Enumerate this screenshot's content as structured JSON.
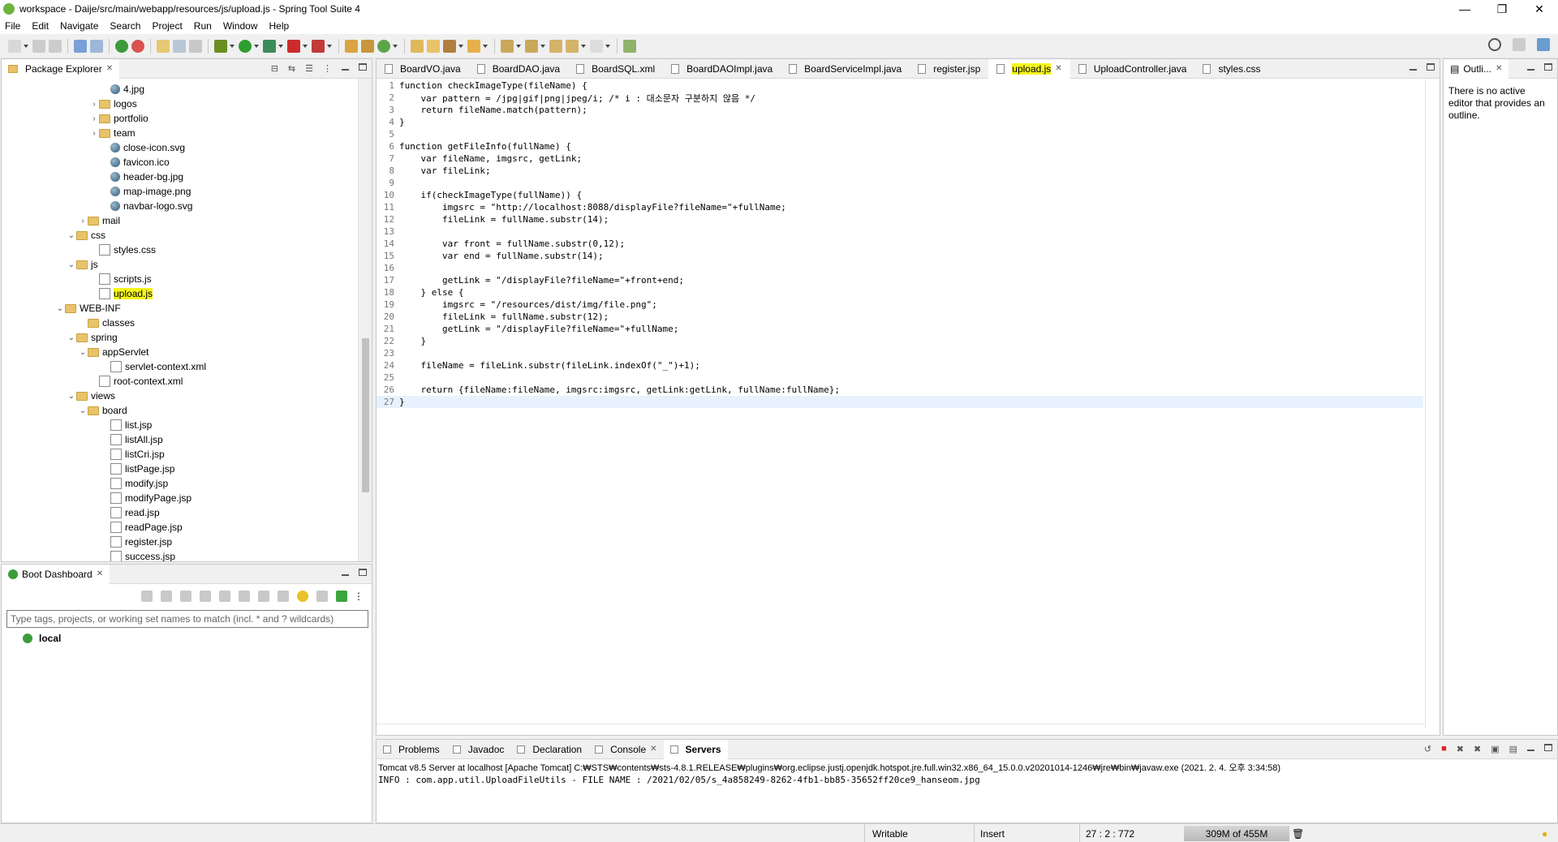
{
  "window": {
    "title": "workspace - Daije/src/main/webapp/resources/js/upload.js - Spring Tool Suite 4"
  },
  "menu": [
    "File",
    "Edit",
    "Navigate",
    "Search",
    "Project",
    "Run",
    "Window",
    "Help"
  ],
  "package_explorer": {
    "title": "Package Explorer",
    "items": [
      {
        "label": "4.jpg",
        "type": "image",
        "level": 9,
        "expander": ""
      },
      {
        "label": "logos",
        "type": "folder",
        "level": 8,
        "expander": ">"
      },
      {
        "label": "portfolio",
        "type": "folder",
        "level": 8,
        "expander": ">"
      },
      {
        "label": "team",
        "type": "folder",
        "level": 8,
        "expander": ">"
      },
      {
        "label": "close-icon.svg",
        "type": "image",
        "level": 9,
        "expander": ""
      },
      {
        "label": "favicon.ico",
        "type": "image",
        "level": 9,
        "expander": ""
      },
      {
        "label": "header-bg.jpg",
        "type": "image",
        "level": 9,
        "expander": ""
      },
      {
        "label": "map-image.png",
        "type": "image",
        "level": 9,
        "expander": ""
      },
      {
        "label": "navbar-logo.svg",
        "type": "image",
        "level": 9,
        "expander": ""
      },
      {
        "label": "mail",
        "type": "folder",
        "level": 7,
        "expander": ">"
      },
      {
        "label": "css",
        "type": "folder",
        "level": 6,
        "expander": "v"
      },
      {
        "label": "styles.css",
        "type": "file",
        "level": 8,
        "expander": ""
      },
      {
        "label": "js",
        "type": "folder",
        "level": 6,
        "expander": "v"
      },
      {
        "label": "scripts.js",
        "type": "file",
        "level": 8,
        "expander": ""
      },
      {
        "label": "upload.js",
        "type": "file",
        "level": 8,
        "expander": "",
        "selected": true
      },
      {
        "label": "WEB-INF",
        "type": "folder",
        "level": 5,
        "expander": "v"
      },
      {
        "label": "classes",
        "type": "folder",
        "level": 7,
        "expander": ""
      },
      {
        "label": "spring",
        "type": "folder",
        "level": 6,
        "expander": "v"
      },
      {
        "label": "appServlet",
        "type": "folder",
        "level": 7,
        "expander": "v"
      },
      {
        "label": "servlet-context.xml",
        "type": "file",
        "level": 9,
        "expander": ""
      },
      {
        "label": "root-context.xml",
        "type": "file",
        "level": 8,
        "expander": ""
      },
      {
        "label": "views",
        "type": "folder",
        "level": 6,
        "expander": "v"
      },
      {
        "label": "board",
        "type": "folder",
        "level": 7,
        "expander": "v"
      },
      {
        "label": "list.jsp",
        "type": "file",
        "level": 9,
        "expander": ""
      },
      {
        "label": "listAll.jsp",
        "type": "file",
        "level": 9,
        "expander": ""
      },
      {
        "label": "listCri.jsp",
        "type": "file",
        "level": 9,
        "expander": ""
      },
      {
        "label": "listPage.jsp",
        "type": "file",
        "level": 9,
        "expander": ""
      },
      {
        "label": "modify.jsp",
        "type": "file",
        "level": 9,
        "expander": ""
      },
      {
        "label": "modifyPage.jsp",
        "type": "file",
        "level": 9,
        "expander": ""
      },
      {
        "label": "read.jsp",
        "type": "file",
        "level": 9,
        "expander": ""
      },
      {
        "label": "readPage.jsp",
        "type": "file",
        "level": 9,
        "expander": ""
      },
      {
        "label": "register.jsp",
        "type": "file",
        "level": 9,
        "expander": ""
      },
      {
        "label": "success.jsp",
        "type": "file",
        "level": 9,
        "expander": ""
      }
    ]
  },
  "boot_dashboard": {
    "title": "Boot Dashboard",
    "filter_placeholder": "Type tags, projects, or working set names to match (incl. * and ? wildcards)",
    "local": "local"
  },
  "editor": {
    "tabs": [
      "BoardVO.java",
      "BoardDAO.java",
      "BoardSQL.xml",
      "BoardDAOImpl.java",
      "BoardServiceImpl.java",
      "register.jsp",
      "upload.js",
      "UploadController.java",
      "styles.css"
    ],
    "active_tab": "upload.js",
    "lines": [
      "function checkImageType(fileName) {",
      "    var pattern = /jpg|gif|png|jpeg/i; /* i : 대소문자 구분하지 않음 */",
      "    return fileName.match(pattern);",
      "}",
      "",
      "function getFileInfo(fullName) {",
      "    var fileName, imgsrc, getLink;",
      "    var fileLink;",
      "",
      "    if(checkImageType(fullName)) {",
      "        imgsrc = \"http://localhost:8088/displayFile?fileName=\"+fullName;",
      "        fileLink = fullName.substr(14);",
      "",
      "        var front = fullName.substr(0,12);",
      "        var end = fullName.substr(14);",
      "",
      "        getLink = \"/displayFile?fileName=\"+front+end;",
      "    } else {",
      "        imgsrc = \"/resources/dist/img/file.png\";",
      "        fileLink = fullName.substr(12);",
      "        getLink = \"/displayFile?fileName=\"+fullName;",
      "    }",
      "",
      "    fileName = fileLink.substr(fileLink.indexOf(\"_\")+1);",
      "",
      "    return {fileName:fileName, imgsrc:imgsrc, getLink:getLink, fullName:fullName};",
      "}"
    ]
  },
  "outline": {
    "title": "Outli...",
    "message": "There is no active editor that provides an outline."
  },
  "console": {
    "tabs": [
      "Problems",
      "Javadoc",
      "Declaration",
      "Console",
      "Servers"
    ],
    "header": "Tomcat v8.5 Server at localhost [Apache Tomcat] C:₩STS₩contents₩sts-4.8.1.RELEASE₩plugins₩org.eclipse.justj.openjdk.hotspot.jre.full.win32.x86_64_15.0.0.v20201014-1246₩jre₩bin₩javaw.exe  (2021. 2. 4. 오후 3:34:58)",
    "log": "INFO : com.app.util.UploadFileUtils - FILE NAME : /2021/02/05/s_4a858249-8262-4fb1-bb85-35652ff20ce9_hanseom.jpg"
  },
  "status": {
    "writable": "Writable",
    "insert": "Insert",
    "position": "27 : 2 : 772",
    "heap": "309M of 455M"
  }
}
